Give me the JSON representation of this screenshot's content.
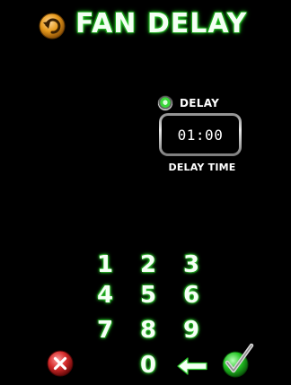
{
  "header": {
    "title": "FAN DELAY",
    "back_icon": "undo-arrow-icon"
  },
  "delay": {
    "radio_label": "DELAY",
    "radio_selected": true,
    "time_value": "01:00",
    "time_label": "DELAY TIME"
  },
  "keypad": {
    "keys": [
      "1",
      "2",
      "3",
      "4",
      "5",
      "6",
      "7",
      "8",
      "9",
      "0"
    ],
    "backspace_icon": "left-arrow-icon"
  },
  "actions": {
    "cancel_icon": "cancel-x-icon",
    "confirm_icon": "checkmark-icon"
  },
  "colors": {
    "background": "#000000",
    "accent_green": "#2fd12f",
    "back_orange": "#e79a1c",
    "cancel_red": "#d42a2a",
    "confirm_green": "#22c422"
  }
}
